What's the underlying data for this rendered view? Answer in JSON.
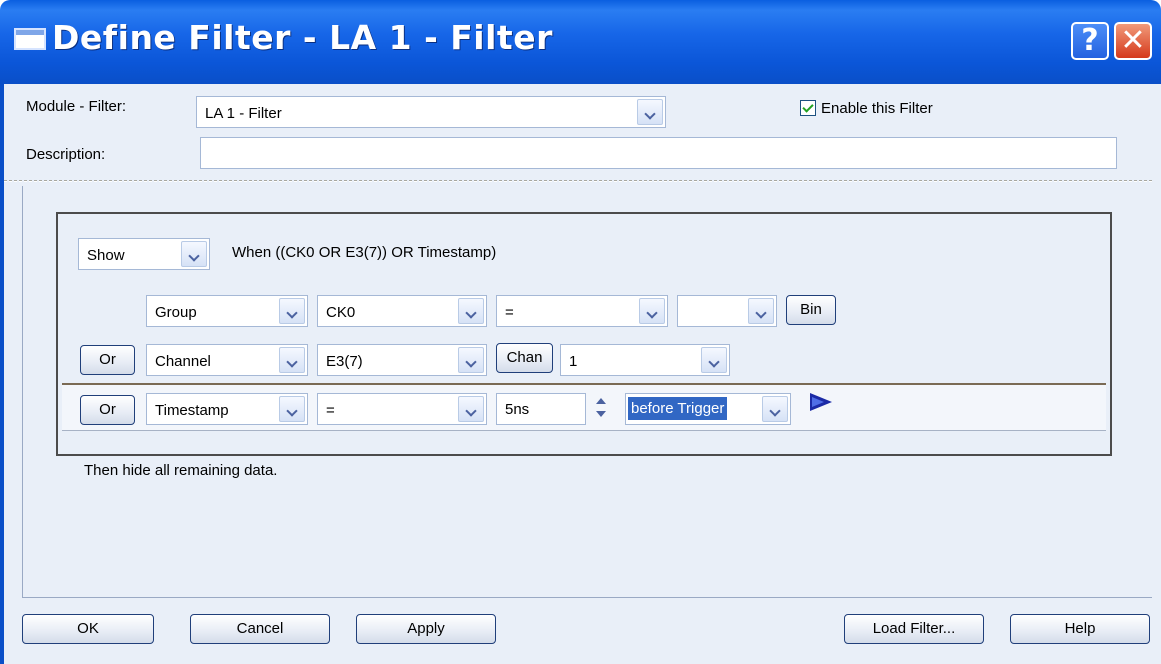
{
  "window": {
    "title": "Define Filter - LA 1 - Filter",
    "help_glyph": "?",
    "close_glyph": "✕",
    "colors": {
      "titlebar": "#0a5fe0",
      "body": "#e9eff8",
      "selection": "#3167c4",
      "close": "#d5391b"
    }
  },
  "header": {
    "module_label": "Module - Filter:",
    "module_value": "LA 1 - Filter",
    "enable_label": "Enable this Filter",
    "enable_checked": true,
    "description_label": "Description:",
    "description_value": ""
  },
  "filter": {
    "action": "Show",
    "expression": "When ((CK0 OR E3(7)) OR Timestamp)",
    "rows": [
      {
        "type": "Group",
        "signal": "CK0",
        "operator": "=",
        "value": "",
        "format_button": "Bin"
      },
      {
        "connector": "Or",
        "type": "Channel",
        "signal": "E3(7)",
        "format_button": "Chan",
        "value": "1"
      },
      {
        "connector": "Or",
        "type": "Timestamp",
        "operator": "=",
        "time_value": "5ns",
        "relation": "before Trigger"
      }
    ],
    "footer_text": "Then hide all remaining data."
  },
  "buttons": {
    "ok": "OK",
    "cancel": "Cancel",
    "apply": "Apply",
    "load_filter": "Load Filter...",
    "help": "Help"
  }
}
